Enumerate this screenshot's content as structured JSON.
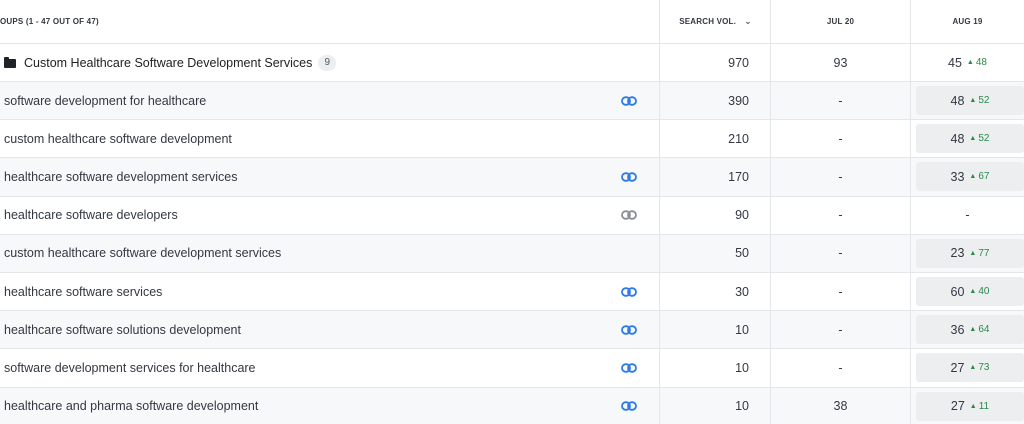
{
  "header": {
    "groups_label": "OUPS (1 - 47 OUT OF 47)",
    "search_vol_label": "SEARCH VOL.",
    "col_jul_label": "JUL 20",
    "col_aug_label": "AUG 19"
  },
  "group": {
    "name": "Custom Healthcare Software Development Services",
    "count": "9",
    "search_vol": "970",
    "jul": "93",
    "aug": "45",
    "aug_delta": "48"
  },
  "colors": {
    "link_active": "#2d7be5",
    "link_inactive": "#8a8f98",
    "delta_up": "#2a8a4b"
  },
  "rows": [
    {
      "keyword": "software development for healthcare",
      "link": "active",
      "search_vol": "390",
      "jul": "-",
      "aug": "48",
      "aug_delta": "52"
    },
    {
      "keyword": "custom healthcare software development",
      "link": "none",
      "search_vol": "210",
      "jul": "-",
      "aug": "48",
      "aug_delta": "52"
    },
    {
      "keyword": "healthcare software development services",
      "link": "active",
      "search_vol": "170",
      "jul": "-",
      "aug": "33",
      "aug_delta": "67"
    },
    {
      "keyword": "healthcare software developers",
      "link": "inactive",
      "search_vol": "90",
      "jul": "-",
      "aug": "-",
      "aug_delta": ""
    },
    {
      "keyword": "custom healthcare software development services",
      "link": "none",
      "search_vol": "50",
      "jul": "-",
      "aug": "23",
      "aug_delta": "77"
    },
    {
      "keyword": "healthcare software services",
      "link": "active",
      "search_vol": "30",
      "jul": "-",
      "aug": "60",
      "aug_delta": "40"
    },
    {
      "keyword": "healthcare software solutions development",
      "link": "active",
      "search_vol": "10",
      "jul": "-",
      "aug": "36",
      "aug_delta": "64"
    },
    {
      "keyword": "software development services for healthcare",
      "link": "active",
      "search_vol": "10",
      "jul": "-",
      "aug": "27",
      "aug_delta": "73"
    },
    {
      "keyword": "healthcare and pharma software development",
      "link": "active",
      "search_vol": "10",
      "jul": "38",
      "aug": "27",
      "aug_delta": "11"
    }
  ]
}
